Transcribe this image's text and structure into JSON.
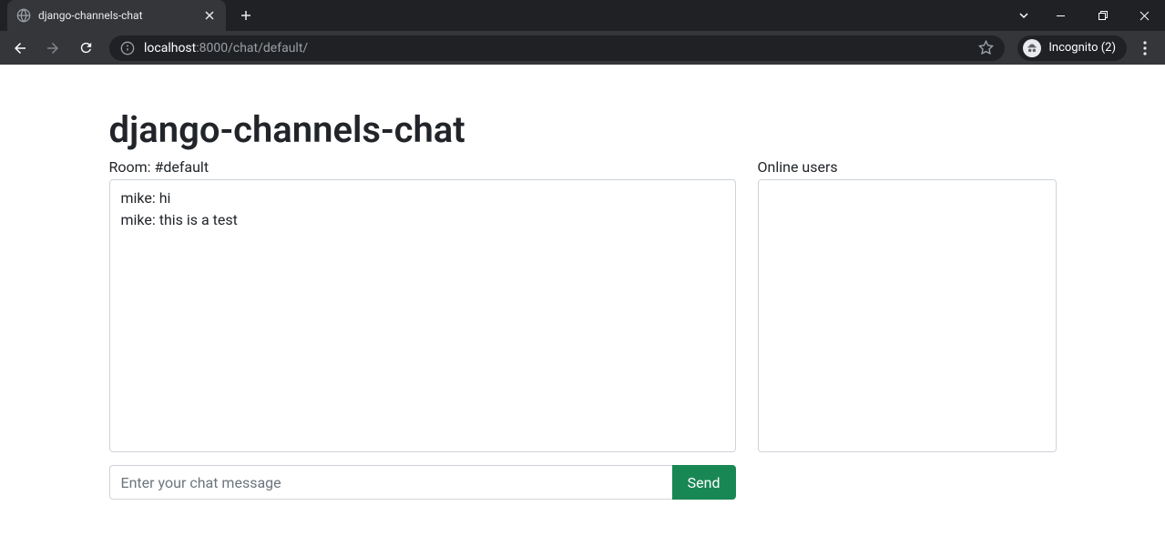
{
  "browser": {
    "tab": {
      "title": "django-channels-chat"
    },
    "url": {
      "host": "localhost",
      "port_path": ":8000/chat/default/"
    },
    "incognito_label": "Incognito (2)"
  },
  "page": {
    "title": "django-channels-chat",
    "room_label": "Room: #default",
    "online_users_label": "Online users",
    "chat_log": "mike: hi\nmike: this is a test",
    "messages": [
      {
        "user": "mike",
        "text": "hi"
      },
      {
        "user": "mike",
        "text": "this is a test"
      }
    ],
    "online_users": [],
    "input_placeholder": "Enter your chat message",
    "send_label": "Send"
  }
}
